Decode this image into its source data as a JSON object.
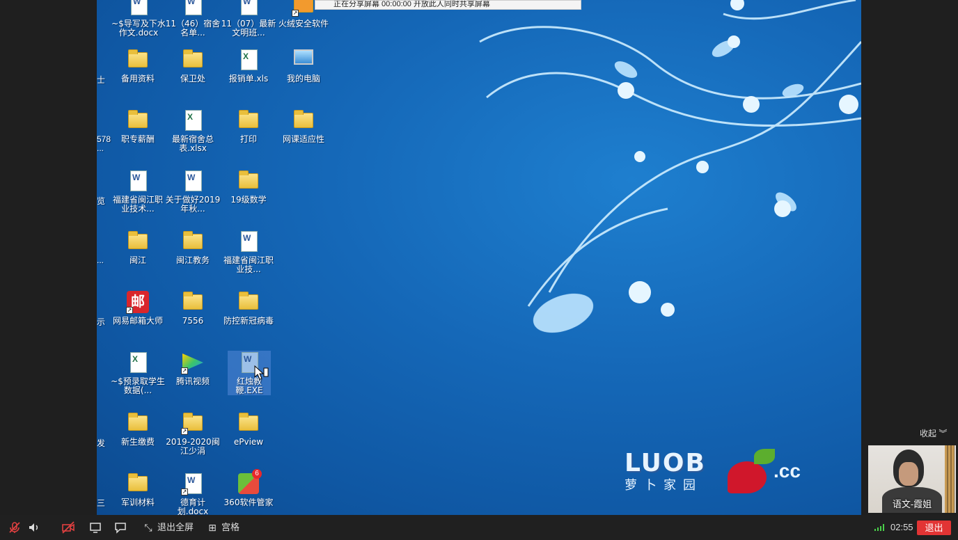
{
  "notice": "正在分享屏幕     00:00:00     开放此人同时共享屏幕",
  "desktop_icons": [
    {
      "label": "~$导写及下水作文.docx",
      "type": "doc"
    },
    {
      "label": "11（46）宿舍名单...",
      "type": "doc"
    },
    {
      "label": "11（07）最新文明班...",
      "type": "doc"
    },
    {
      "label": "火绒安全软件",
      "type": "app"
    },
    {
      "label": "备用资料",
      "type": "folder"
    },
    {
      "label": "保卫处",
      "type": "folder"
    },
    {
      "label": "报销单.xls",
      "type": "xls"
    },
    {
      "label": "我的电脑",
      "type": "pc"
    },
    {
      "label": "职专薪酬",
      "type": "folder"
    },
    {
      "label": "最新宿舍总表.xlsx",
      "type": "xls"
    },
    {
      "label": "打印",
      "type": "folder"
    },
    {
      "label": "网课适应性",
      "type": "folder"
    },
    {
      "label": "福建省闽江职业技术...",
      "type": "doc"
    },
    {
      "label": "关于做好2019年秋...",
      "type": "doc"
    },
    {
      "label": "19级数学",
      "type": "folder"
    },
    {
      "label": "闽江",
      "type": "folder"
    },
    {
      "label": "闽江教务",
      "type": "folder"
    },
    {
      "label": "福建省闽江职业技...",
      "type": "doc"
    },
    {
      "label": "网易邮箱大师",
      "type": "mail"
    },
    {
      "label": "7556",
      "type": "folder"
    },
    {
      "label": "防控新冠病毒",
      "type": "folder"
    },
    {
      "label": "~$预录取学生数据(...",
      "type": "xls"
    },
    {
      "label": "腾讯视频",
      "type": "video"
    },
    {
      "label": "红烛教鞭.EXE",
      "type": "exe"
    },
    {
      "label": "新生缴费",
      "type": "folder"
    },
    {
      "label": "2019-2020闽江少涓",
      "type": "folder"
    },
    {
      "label": "ePview",
      "type": "folder"
    },
    {
      "label": "军训材料",
      "type": "folder"
    },
    {
      "label": "德育计划.docx",
      "type": "doc"
    },
    {
      "label": "360软件管家",
      "type": "ms360"
    }
  ],
  "partial_edge_labels": [
    "士",
    "578",
    "...",
    "览",
    "...",
    "示",
    "发",
    "三"
  ],
  "brand_logo": {
    "t1": "LUOB",
    "t2": "萝卜家园",
    "cc": ".cc"
  },
  "badge_360": "6",
  "video_panel": {
    "name": "语文-霞姐",
    "collapse_label": "收起"
  },
  "toolbar": {
    "exit_fullscreen": "退出全屏",
    "grid": "宫格",
    "time": "02:55",
    "exit": "退出"
  }
}
